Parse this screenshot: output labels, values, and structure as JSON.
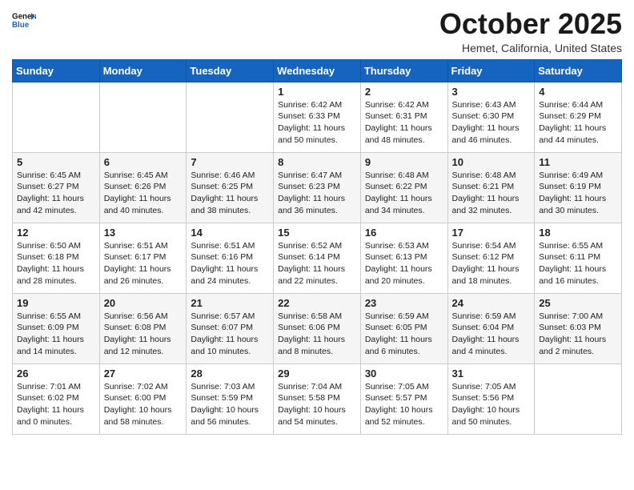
{
  "header": {
    "logo_line1": "General",
    "logo_line2": "Blue",
    "month_title": "October 2025",
    "location": "Hemet, California, United States"
  },
  "days_of_week": [
    "Sunday",
    "Monday",
    "Tuesday",
    "Wednesday",
    "Thursday",
    "Friday",
    "Saturday"
  ],
  "weeks": [
    [
      {
        "day": "",
        "info": ""
      },
      {
        "day": "",
        "info": ""
      },
      {
        "day": "",
        "info": ""
      },
      {
        "day": "1",
        "info": "Sunrise: 6:42 AM\nSunset: 6:33 PM\nDaylight: 11 hours\nand 50 minutes."
      },
      {
        "day": "2",
        "info": "Sunrise: 6:42 AM\nSunset: 6:31 PM\nDaylight: 11 hours\nand 48 minutes."
      },
      {
        "day": "3",
        "info": "Sunrise: 6:43 AM\nSunset: 6:30 PM\nDaylight: 11 hours\nand 46 minutes."
      },
      {
        "day": "4",
        "info": "Sunrise: 6:44 AM\nSunset: 6:29 PM\nDaylight: 11 hours\nand 44 minutes."
      }
    ],
    [
      {
        "day": "5",
        "info": "Sunrise: 6:45 AM\nSunset: 6:27 PM\nDaylight: 11 hours\nand 42 minutes."
      },
      {
        "day": "6",
        "info": "Sunrise: 6:45 AM\nSunset: 6:26 PM\nDaylight: 11 hours\nand 40 minutes."
      },
      {
        "day": "7",
        "info": "Sunrise: 6:46 AM\nSunset: 6:25 PM\nDaylight: 11 hours\nand 38 minutes."
      },
      {
        "day": "8",
        "info": "Sunrise: 6:47 AM\nSunset: 6:23 PM\nDaylight: 11 hours\nand 36 minutes."
      },
      {
        "day": "9",
        "info": "Sunrise: 6:48 AM\nSunset: 6:22 PM\nDaylight: 11 hours\nand 34 minutes."
      },
      {
        "day": "10",
        "info": "Sunrise: 6:48 AM\nSunset: 6:21 PM\nDaylight: 11 hours\nand 32 minutes."
      },
      {
        "day": "11",
        "info": "Sunrise: 6:49 AM\nSunset: 6:19 PM\nDaylight: 11 hours\nand 30 minutes."
      }
    ],
    [
      {
        "day": "12",
        "info": "Sunrise: 6:50 AM\nSunset: 6:18 PM\nDaylight: 11 hours\nand 28 minutes."
      },
      {
        "day": "13",
        "info": "Sunrise: 6:51 AM\nSunset: 6:17 PM\nDaylight: 11 hours\nand 26 minutes."
      },
      {
        "day": "14",
        "info": "Sunrise: 6:51 AM\nSunset: 6:16 PM\nDaylight: 11 hours\nand 24 minutes."
      },
      {
        "day": "15",
        "info": "Sunrise: 6:52 AM\nSunset: 6:14 PM\nDaylight: 11 hours\nand 22 minutes."
      },
      {
        "day": "16",
        "info": "Sunrise: 6:53 AM\nSunset: 6:13 PM\nDaylight: 11 hours\nand 20 minutes."
      },
      {
        "day": "17",
        "info": "Sunrise: 6:54 AM\nSunset: 6:12 PM\nDaylight: 11 hours\nand 18 minutes."
      },
      {
        "day": "18",
        "info": "Sunrise: 6:55 AM\nSunset: 6:11 PM\nDaylight: 11 hours\nand 16 minutes."
      }
    ],
    [
      {
        "day": "19",
        "info": "Sunrise: 6:55 AM\nSunset: 6:09 PM\nDaylight: 11 hours\nand 14 minutes."
      },
      {
        "day": "20",
        "info": "Sunrise: 6:56 AM\nSunset: 6:08 PM\nDaylight: 11 hours\nand 12 minutes."
      },
      {
        "day": "21",
        "info": "Sunrise: 6:57 AM\nSunset: 6:07 PM\nDaylight: 11 hours\nand 10 minutes."
      },
      {
        "day": "22",
        "info": "Sunrise: 6:58 AM\nSunset: 6:06 PM\nDaylight: 11 hours\nand 8 minutes."
      },
      {
        "day": "23",
        "info": "Sunrise: 6:59 AM\nSunset: 6:05 PM\nDaylight: 11 hours\nand 6 minutes."
      },
      {
        "day": "24",
        "info": "Sunrise: 6:59 AM\nSunset: 6:04 PM\nDaylight: 11 hours\nand 4 minutes."
      },
      {
        "day": "25",
        "info": "Sunrise: 7:00 AM\nSunset: 6:03 PM\nDaylight: 11 hours\nand 2 minutes."
      }
    ],
    [
      {
        "day": "26",
        "info": "Sunrise: 7:01 AM\nSunset: 6:02 PM\nDaylight: 11 hours\nand 0 minutes."
      },
      {
        "day": "27",
        "info": "Sunrise: 7:02 AM\nSunset: 6:00 PM\nDaylight: 10 hours\nand 58 minutes."
      },
      {
        "day": "28",
        "info": "Sunrise: 7:03 AM\nSunset: 5:59 PM\nDaylight: 10 hours\nand 56 minutes."
      },
      {
        "day": "29",
        "info": "Sunrise: 7:04 AM\nSunset: 5:58 PM\nDaylight: 10 hours\nand 54 minutes."
      },
      {
        "day": "30",
        "info": "Sunrise: 7:05 AM\nSunset: 5:57 PM\nDaylight: 10 hours\nand 52 minutes."
      },
      {
        "day": "31",
        "info": "Sunrise: 7:05 AM\nSunset: 5:56 PM\nDaylight: 10 hours\nand 50 minutes."
      },
      {
        "day": "",
        "info": ""
      }
    ]
  ]
}
